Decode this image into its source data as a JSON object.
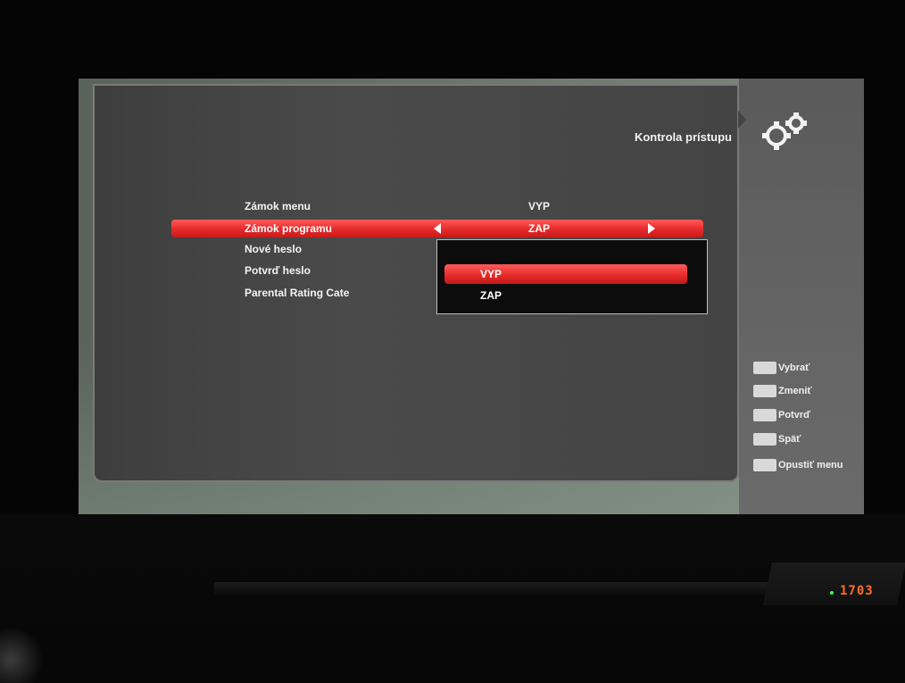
{
  "header": {
    "title": "Kontrola prístupu",
    "icon": "gear-icon"
  },
  "menu": {
    "rows": [
      {
        "label": "Zámok menu",
        "value": "VYP"
      },
      {
        "label": "Zámok programu",
        "value": "ZAP"
      },
      {
        "label": "Nové heslo",
        "value": ""
      },
      {
        "label": "Potvrď heslo",
        "value": ""
      },
      {
        "label": "Parental Rating Cate",
        "value": ""
      }
    ],
    "selected_index": 1
  },
  "dropdown": {
    "options": [
      "VYP",
      "ZAP"
    ],
    "selected": "VYP"
  },
  "hints": [
    {
      "label": "Vybrať"
    },
    {
      "label": "Zmeniť"
    },
    {
      "label": "Potvrď"
    },
    {
      "label": "Späť"
    },
    {
      "label": "Opustiť menu"
    }
  ],
  "receiver": {
    "display": "1703"
  },
  "colors": {
    "accent": "#e52a2a",
    "panel": "#444444",
    "led": "#3aff4a",
    "display": "#ff6a2b"
  }
}
